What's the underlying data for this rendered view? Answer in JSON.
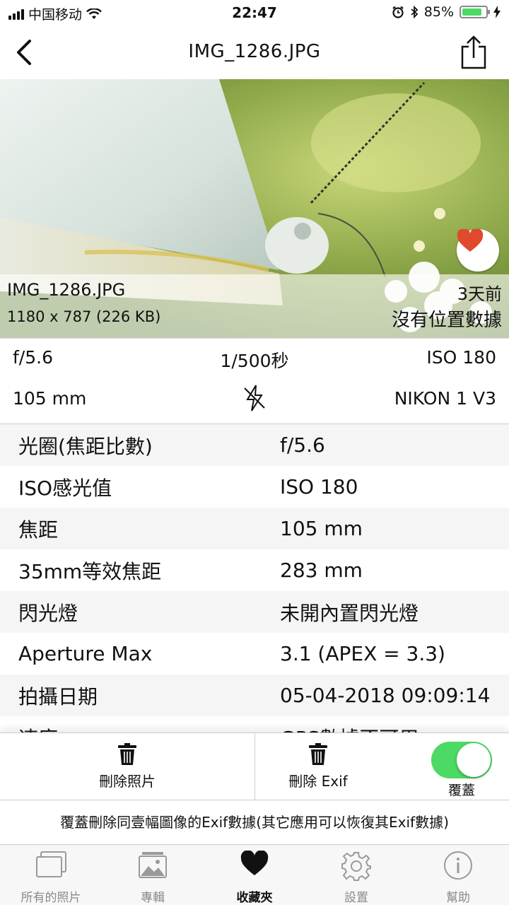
{
  "status_bar": {
    "carrier": "中国移动",
    "time": "22:47",
    "battery": "85%",
    "battery_level": 0.85
  },
  "nav": {
    "title": "IMG_1286.JPG"
  },
  "photo": {
    "filename": "IMG_1286.JPG",
    "dimensions": "1180 x 787 (226 KB)",
    "age": "3天前",
    "location": "沒有位置數據"
  },
  "summary": {
    "aperture": "f/5.6",
    "shutter": "1/500秒",
    "iso": "ISO 180",
    "focal": "105 mm",
    "camera": "NIKON 1 V3",
    "flash_icon": "flash-off-icon"
  },
  "details": {
    "rows": [
      {
        "key": "光圈(焦距比數)",
        "value": "f/5.6"
      },
      {
        "key": "ISO感光值",
        "value": "ISO 180"
      },
      {
        "key": "焦距",
        "value": "105 mm"
      },
      {
        "key": "35mm等效焦距",
        "value": "283 mm"
      },
      {
        "key": "閃光燈",
        "value": "未開內置閃光燈"
      },
      {
        "key": "Aperture Max",
        "value": "3.1 (APEX = 3.3)"
      },
      {
        "key": "拍攝日期",
        "value": "05-04-2018 09:09:14"
      },
      {
        "key": "速度",
        "value": "GPS數據不可用"
      }
    ]
  },
  "actions": {
    "delete_photo": "刪除照片",
    "delete_exif": "刪除 Exif",
    "overwrite": "覆蓋",
    "overwrite_on": true
  },
  "info": {
    "text": "覆蓋刪除同壹幅圖像的Exif數據(其它應用可以恢復其Exif數據)"
  },
  "tabs": [
    {
      "label": "所有的照片",
      "icon": "photos-icon"
    },
    {
      "label": "專輯",
      "icon": "album-icon"
    },
    {
      "label": "收藏夾",
      "icon": "heart-icon"
    },
    {
      "label": "設置",
      "icon": "gear-icon"
    },
    {
      "label": "幫助",
      "icon": "info-icon"
    }
  ],
  "colors": {
    "accent_green": "#4cd964",
    "favorite_red": "#e0492c",
    "tab_inactive": "#8a8a8a"
  }
}
